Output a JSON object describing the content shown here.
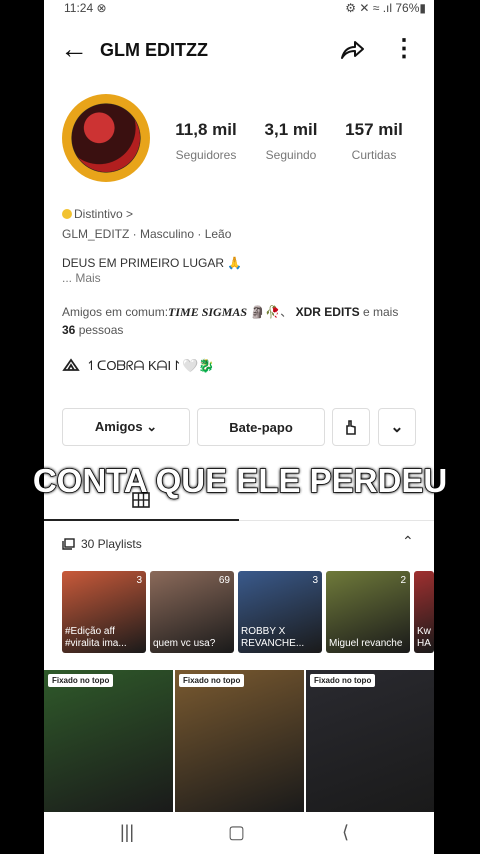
{
  "status": {
    "time": "11:24 ⊗",
    "right": "⚙ ✕ ≈ .ıl 76%▮"
  },
  "header": {
    "username": "GLM EDITZZ"
  },
  "stats": [
    {
      "value": "11,8 mil",
      "label": "Seguidores"
    },
    {
      "value": "3,1 mil",
      "label": "Seguindo"
    },
    {
      "value": "157 mil",
      "label": "Curtidas"
    }
  ],
  "bio": {
    "badge": "Distintivo >",
    "meta": "GLM_EDITZ · Masculino · Leão",
    "line1": "DEUS EM PRIMEIRO LUGAR 🙏",
    "more": "... Mais"
  },
  "friends": {
    "prefix": "Amigos em comum:",
    "name1": "TIME SIGMAS",
    "sep": " 🗿🥀、",
    "name2": "XDR EDITS",
    "suffix": " e mais",
    "count": "36",
    "count_suffix": " pessoas"
  },
  "link_text": "↿ᑕOᗷᖇᗩ KᗩI↾🤍🐉",
  "buttons": {
    "friends": "Amigos ⌄",
    "chat": "Bate-papo"
  },
  "overlay": "CONTA QUE ELE PERDEU",
  "playlists": {
    "header": "30 Playlists",
    "items": [
      {
        "count": "3",
        "title": "#Edição aff #viralita ima...",
        "color": "#c95a3a"
      },
      {
        "count": "69",
        "title": "quem vc usa?",
        "color": "#8b6a5a"
      },
      {
        "count": "3",
        "title": "ROBBY X REVANCHE...",
        "color": "#3a5a8c"
      },
      {
        "count": "2",
        "title": "Miguel revanche",
        "color": "#6f7a3a"
      },
      {
        "count": "",
        "title": "Kw HA",
        "color": "#a03030"
      }
    ]
  },
  "videos": [
    {
      "pin": "Fixado no topo",
      "color": "#2f5a2a"
    },
    {
      "pin": "Fixado no topo",
      "color": "#7a5a30"
    },
    {
      "pin": "Fixado no topo",
      "color": "#2a2a30"
    }
  ]
}
